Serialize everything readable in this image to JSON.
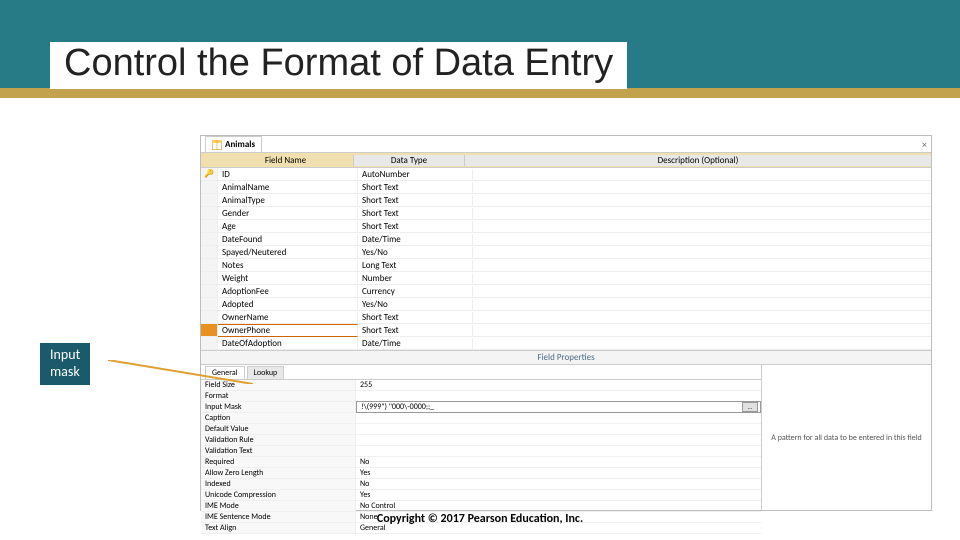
{
  "slide": {
    "title": "Control the Format of Data Entry",
    "copyright": "Copyright © 2017 Pearson Education, Inc."
  },
  "callout": {
    "line1": "Input",
    "line2": "mask"
  },
  "table": {
    "tab_name": "Animals",
    "headers": {
      "field_name": "Field Name",
      "data_type": "Data Type",
      "description": "Description (Optional)"
    },
    "rows": [
      {
        "name": "ID",
        "type": "AutoNumber",
        "key": true
      },
      {
        "name": "AnimalName",
        "type": "Short Text"
      },
      {
        "name": "AnimalType",
        "type": "Short Text"
      },
      {
        "name": "Gender",
        "type": "Short Text"
      },
      {
        "name": "Age",
        "type": "Short Text"
      },
      {
        "name": "DateFound",
        "type": "Date/Time"
      },
      {
        "name": "Spayed/Neutered",
        "type": "Yes/No"
      },
      {
        "name": "Notes",
        "type": "Long Text"
      },
      {
        "name": "Weight",
        "type": "Number"
      },
      {
        "name": "AdoptionFee",
        "type": "Currency"
      },
      {
        "name": "Adopted",
        "type": "Yes/No"
      },
      {
        "name": "OwnerName",
        "type": "Short Text"
      },
      {
        "name": "OwnerPhone",
        "type": "Short Text",
        "selected": true
      },
      {
        "name": "DateOfAdoption",
        "type": "Date/Time"
      }
    ]
  },
  "properties": {
    "pane_title": "Field Properties",
    "tab_general": "General",
    "tab_lookup": "Lookup",
    "hint": "A pattern for all data to be entered in this field",
    "rows": [
      {
        "name": "Field Size",
        "value": "255"
      },
      {
        "name": "Format",
        "value": ""
      },
      {
        "name": "Input Mask",
        "value": "!\\(999\") \"000\\-0000;;_",
        "hilite": true
      },
      {
        "name": "Caption",
        "value": ""
      },
      {
        "name": "Default Value",
        "value": ""
      },
      {
        "name": "Validation Rule",
        "value": ""
      },
      {
        "name": "Validation Text",
        "value": ""
      },
      {
        "name": "Required",
        "value": "No"
      },
      {
        "name": "Allow Zero Length",
        "value": "Yes"
      },
      {
        "name": "Indexed",
        "value": "No"
      },
      {
        "name": "Unicode Compression",
        "value": "Yes"
      },
      {
        "name": "IME Mode",
        "value": "No Control"
      },
      {
        "name": "IME Sentence Mode",
        "value": "None"
      },
      {
        "name": "Text Align",
        "value": "General"
      }
    ]
  }
}
